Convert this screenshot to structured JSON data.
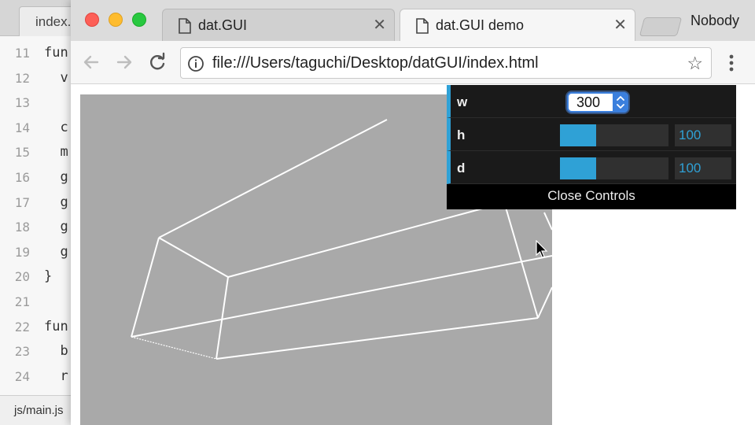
{
  "editor": {
    "tab_label": "index.",
    "status_text": "js/main.js",
    "lines": [
      {
        "num": "11",
        "code": "fun"
      },
      {
        "num": "12",
        "code": "  v"
      },
      {
        "num": "13",
        "code": ""
      },
      {
        "num": "14",
        "code": "  c"
      },
      {
        "num": "15",
        "code": "  m"
      },
      {
        "num": "16",
        "code": "  g"
      },
      {
        "num": "17",
        "code": "  g"
      },
      {
        "num": "18",
        "code": "  g"
      },
      {
        "num": "19",
        "code": "  g"
      },
      {
        "num": "20",
        "code": "}"
      },
      {
        "num": "21",
        "code": ""
      },
      {
        "num": "22",
        "code": "fun"
      },
      {
        "num": "23",
        "code": "  b"
      },
      {
        "num": "24",
        "code": "  r"
      }
    ]
  },
  "browser": {
    "tabs": [
      {
        "title": "dat.GUI",
        "active": false
      },
      {
        "title": "dat.GUI demo",
        "active": true
      }
    ],
    "profile_name": "Nobody",
    "url": "file:///Users/taguchi/Desktop/datGUI/index.html"
  },
  "gui": {
    "w": {
      "label": "w",
      "value": "300"
    },
    "h": {
      "label": "h",
      "value": "100",
      "fill_fraction": 0.33
    },
    "d": {
      "label": "d",
      "value": "100",
      "fill_fraction": 0.33
    },
    "close_label": "Close Controls"
  },
  "colors": {
    "gui_accent": "#2fa1d6",
    "canvas_bg": "#a9a9a9",
    "wireframe": "#ffffff"
  },
  "icons": [
    "page-icon",
    "close-icon",
    "back-arrow-icon",
    "forward-arrow-icon",
    "reload-icon",
    "info-icon",
    "star-icon",
    "menu-dots-icon",
    "spinner-icon",
    "mouse-cursor-icon"
  ]
}
